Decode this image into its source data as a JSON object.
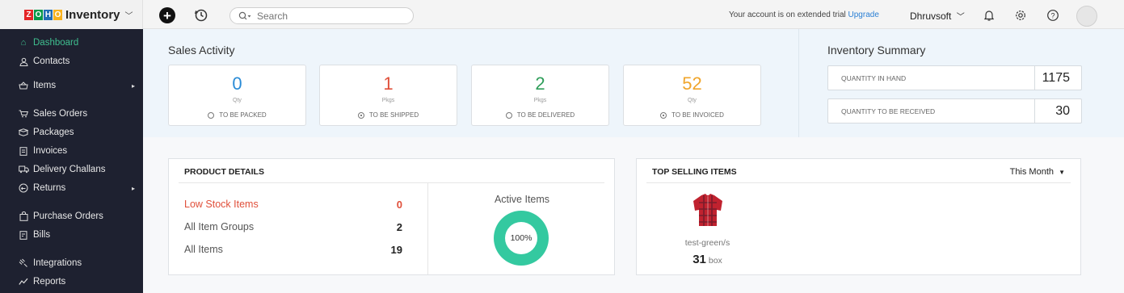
{
  "brand": {
    "name": "Inventory",
    "logo_letters": [
      "Z",
      "O",
      "H",
      "O"
    ],
    "logo_colors": [
      "#e42527",
      "#089949",
      "#226db4",
      "#f9b21d"
    ]
  },
  "topbar": {
    "search_placeholder": "Search",
    "trial_text": "Your account is on extended trial",
    "upgrade_label": "Upgrade",
    "org_name": "Dhruvsoft"
  },
  "sidebar": {
    "items": [
      {
        "label": "Dashboard",
        "icon": "home-icon",
        "active": true
      },
      {
        "label": "Contacts",
        "icon": "user-icon"
      },
      {
        "label": "Items",
        "icon": "items-icon",
        "submenu": true
      },
      {
        "label": "Sales Orders",
        "icon": "cart-icon"
      },
      {
        "label": "Packages",
        "icon": "package-icon"
      },
      {
        "label": "Invoices",
        "icon": "invoice-icon"
      },
      {
        "label": "Delivery Challans",
        "icon": "truck-icon"
      },
      {
        "label": "Returns",
        "icon": "returns-icon",
        "submenu": true
      },
      {
        "label": "Purchase Orders",
        "icon": "bag-icon"
      },
      {
        "label": "Bills",
        "icon": "bill-icon"
      },
      {
        "label": "Integrations",
        "icon": "integrations-icon"
      },
      {
        "label": "Reports",
        "icon": "reports-icon"
      }
    ]
  },
  "sales_activity": {
    "title": "Sales Activity",
    "cards": [
      {
        "value": "0",
        "unit": "Qty",
        "label": "TO BE PACKED",
        "color": "#2a8bd6"
      },
      {
        "value": "1",
        "unit": "Pkgs",
        "label": "TO BE SHIPPED",
        "color": "#e04f3a"
      },
      {
        "value": "2",
        "unit": "Pkgs",
        "label": "TO BE DELIVERED",
        "color": "#2f9e5a"
      },
      {
        "value": "52",
        "unit": "Qty",
        "label": "TO BE INVOICED",
        "color": "#f0a52b"
      }
    ]
  },
  "inventory_summary": {
    "title": "Inventory Summary",
    "rows": [
      {
        "label": "QUANTITY IN HAND",
        "value": "1175"
      },
      {
        "label": "QUANTITY TO BE RECEIVED",
        "value": "30"
      }
    ]
  },
  "product_details": {
    "title": "PRODUCT DETAILS",
    "rows": [
      {
        "label": "Low Stock Items",
        "value": "0"
      },
      {
        "label": "All Item Groups",
        "value": "2"
      },
      {
        "label": "All Items",
        "value": "19"
      }
    ],
    "active_items_title": "Active Items",
    "active_items_percent": "100%",
    "active_color": "#34c9a0"
  },
  "top_selling": {
    "title": "TOP SELLING ITEMS",
    "period": "This Month",
    "item_name": "test-green/s",
    "item_qty": "31",
    "item_unit": "box"
  }
}
